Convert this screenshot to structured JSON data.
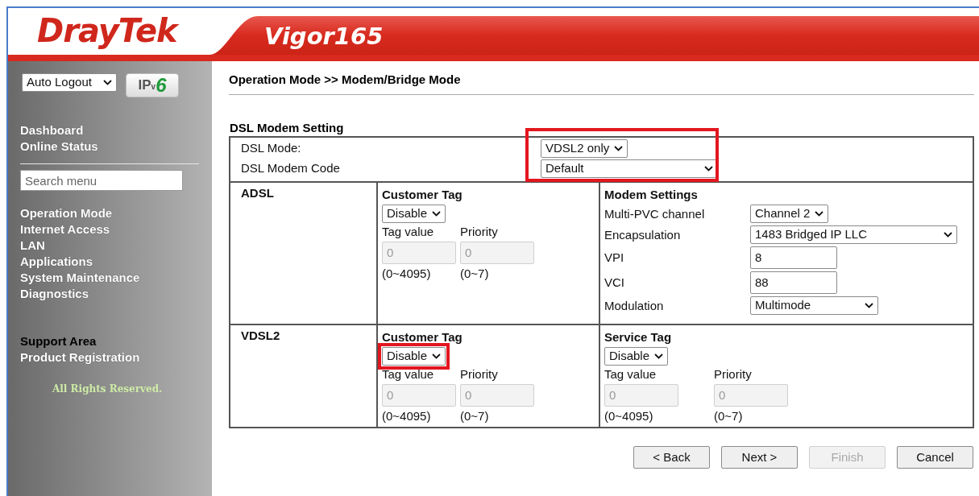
{
  "header": {
    "brand": "DrayTek",
    "model": "Vigor165"
  },
  "sidebar": {
    "auto_logout": {
      "value": "Auto Logout"
    },
    "ipv6_button": {
      "prefix": "IP",
      "sub": "v",
      "suffix": "6"
    },
    "top_items": [
      "Dashboard",
      "Online Status"
    ],
    "search": {
      "placeholder": "Search menu"
    },
    "menu_items": [
      "Operation Mode",
      "Internet Access",
      "LAN",
      "Applications",
      "System Maintenance",
      "Diagnostics"
    ],
    "support_items": [
      {
        "label": "Support Area",
        "kind": "heading"
      },
      {
        "label": "Product Registration",
        "kind": "link"
      }
    ],
    "footer": "All Rights Reserved."
  },
  "page_title": "Operation Mode >> Modem/Bridge Mode",
  "section_title": "DSL Modem Setting",
  "dsl_settings": {
    "highlighted": true,
    "rows": [
      {
        "label": "DSL Mode:",
        "value": "VDSL2 only"
      },
      {
        "label": "DSL Modem Code",
        "value": "Default"
      }
    ]
  },
  "lines": [
    {
      "name": "ADSL",
      "customer_tag": {
        "title": "Customer Tag",
        "select": {
          "value": "Disable",
          "highlighted": false
        },
        "fields": [
          {
            "label": "Tag value",
            "value": "0",
            "range": "(0~4095)",
            "disabled": true
          },
          {
            "label": "Priority",
            "value": "0",
            "range": "(0~7)",
            "disabled": true
          }
        ]
      },
      "right_panel": {
        "kind": "modem",
        "title": "Modem Settings",
        "rows": [
          {
            "label": "Multi-PVC channel",
            "value": "Channel 2",
            "kind": "select"
          },
          {
            "label": "Encapsulation",
            "value": "1483 Bridged IP LLC",
            "kind": "select"
          },
          {
            "label": "VPI",
            "value": "8",
            "kind": "input"
          },
          {
            "label": "VCI",
            "value": "88",
            "kind": "input"
          },
          {
            "label": "Modulation",
            "value": "Multimode",
            "kind": "select"
          }
        ]
      }
    },
    {
      "name": "VDSL2",
      "customer_tag": {
        "title": "Customer Tag",
        "select": {
          "value": "Disable",
          "highlighted": true
        },
        "fields": [
          {
            "label": "Tag value",
            "value": "0",
            "range": "(0~4095)",
            "disabled": true
          },
          {
            "label": "Priority",
            "value": "0",
            "range": "(0~7)",
            "disabled": true
          }
        ]
      },
      "right_panel": {
        "kind": "tag",
        "title": "Service Tag",
        "select": {
          "value": "Disable",
          "highlighted": false
        },
        "fields": [
          {
            "label": "Tag value",
            "value": "0",
            "range": "(0~4095)",
            "disabled": true
          },
          {
            "label": "Priority",
            "value": "0",
            "range": "(0~7)",
            "disabled": true
          }
        ]
      }
    }
  ],
  "buttons": [
    {
      "label": "< Back",
      "disabled": false
    },
    {
      "label": "Next >",
      "disabled": false
    },
    {
      "label": "Finish",
      "disabled": true
    },
    {
      "label": "Cancel",
      "disabled": false
    }
  ]
}
